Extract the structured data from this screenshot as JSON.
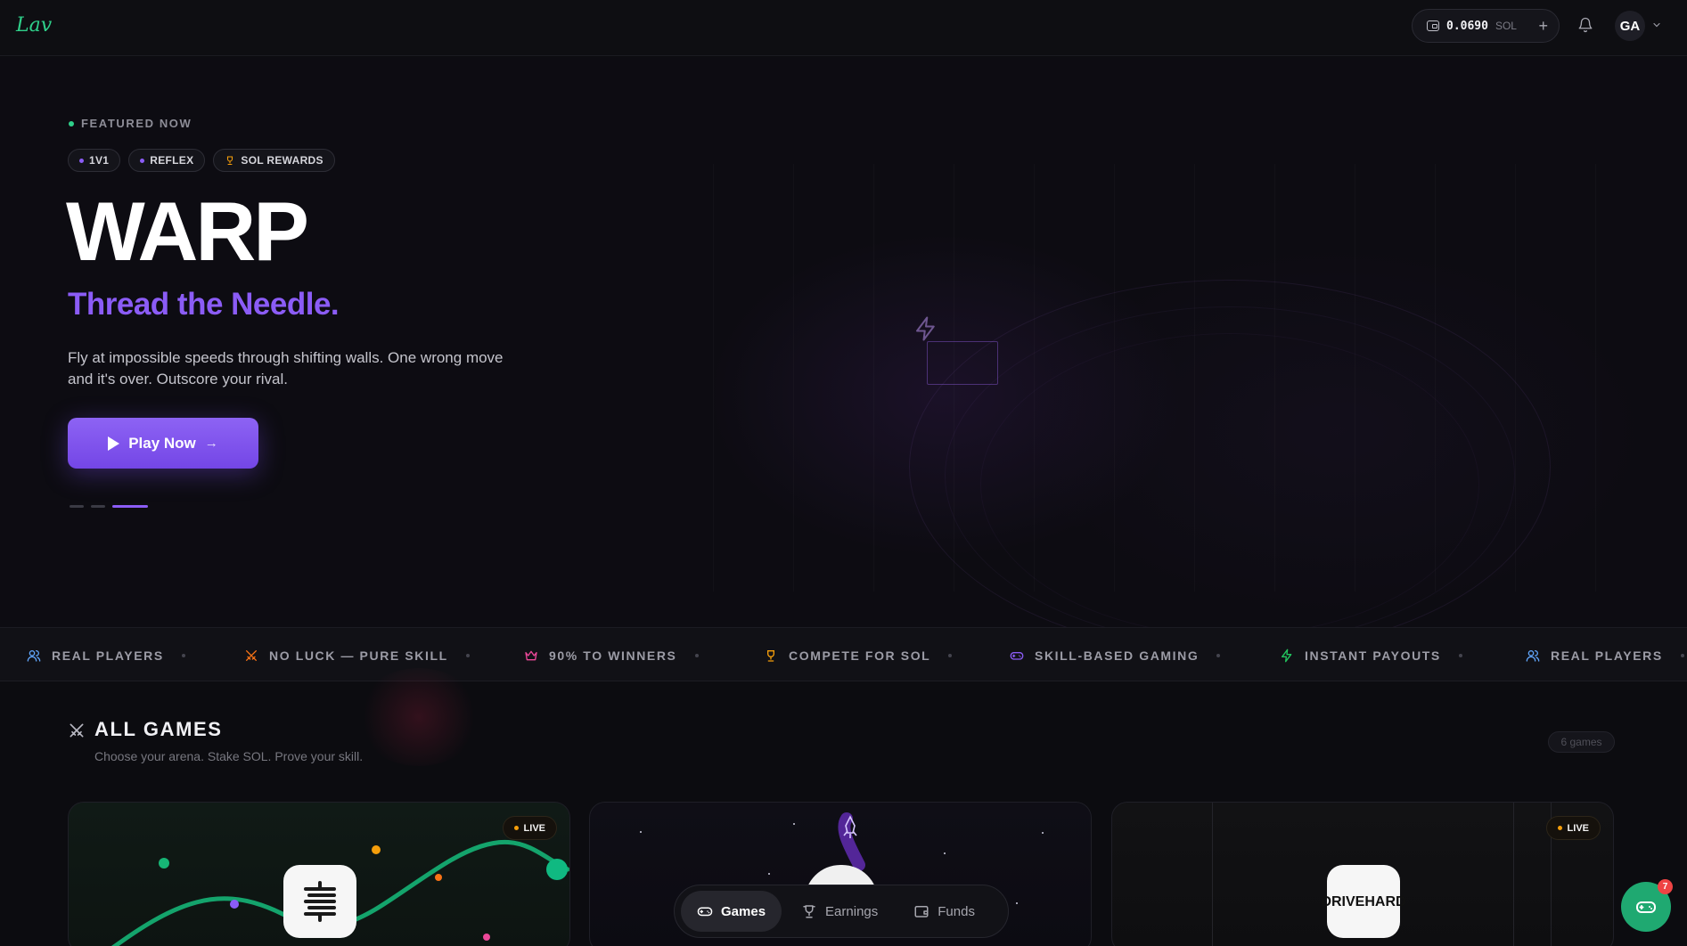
{
  "header": {
    "logo_text": "Lav",
    "wallet": {
      "amount": "0.0690",
      "unit": "SOL",
      "add_label": "+"
    },
    "avatar_initials": "GA"
  },
  "hero": {
    "kicker": "FEATURED NOW",
    "tags": [
      {
        "label": "1V1",
        "icon": "dot-icon"
      },
      {
        "label": "REFLEX",
        "icon": "dot-icon"
      },
      {
        "label": "SOL REWARDS",
        "icon": "trophy-icon"
      }
    ],
    "title": "WARP",
    "tagline": "Thread the Needle.",
    "description": "Fly at impossible speeds through shifting walls. One wrong move and it's over. Outscore your rival.",
    "cta_label": "Play Now",
    "slides_total": 3,
    "active_slide": 3
  },
  "ticker": [
    {
      "label": "REAL PLAYERS",
      "icon": "users-icon",
      "color": "#60a5fa"
    },
    {
      "label": "NO LUCK — PURE SKILL",
      "icon": "swords-icon",
      "color": "#f97316"
    },
    {
      "label": "90% TO WINNERS",
      "icon": "crown-icon",
      "color": "#ec4899"
    },
    {
      "label": "COMPETE FOR SOL",
      "icon": "trophy-icon",
      "color": "#f59e0b"
    },
    {
      "label": "SKILL-BASED GAMING",
      "icon": "gamepad-icon",
      "color": "#8b5cf6"
    },
    {
      "label": "INSTANT PAYOUTS",
      "icon": "bolt-icon",
      "color": "#22c55e"
    },
    {
      "label": "REAL PLAYERS",
      "icon": "users-icon",
      "color": "#60a5fa"
    }
  ],
  "games": {
    "title": "ALL GAMES",
    "subtitle": "Choose your arena. Stake SOL. Prove your skill.",
    "count_label": "6 games",
    "cards": [
      {
        "live": true,
        "live_label": "LIVE",
        "icon": "snake-maze-icon"
      },
      {
        "live": false,
        "icon": "rocket-icon"
      },
      {
        "live": true,
        "live_label": "LIVE",
        "icon_text": "DRIVE HARD"
      }
    ]
  },
  "bottom_nav": [
    {
      "label": "Games",
      "icon": "gamepad-icon",
      "active": true
    },
    {
      "label": "Earnings",
      "icon": "trophy-icon",
      "active": false
    },
    {
      "label": "Funds",
      "icon": "wallet-icon",
      "active": false
    }
  ],
  "chat_badge": "7",
  "colors": {
    "accent": "#8b5cf6",
    "brand_green": "#2fd08a",
    "live_dot": "#f59e0b",
    "fab": "#1fa971"
  }
}
